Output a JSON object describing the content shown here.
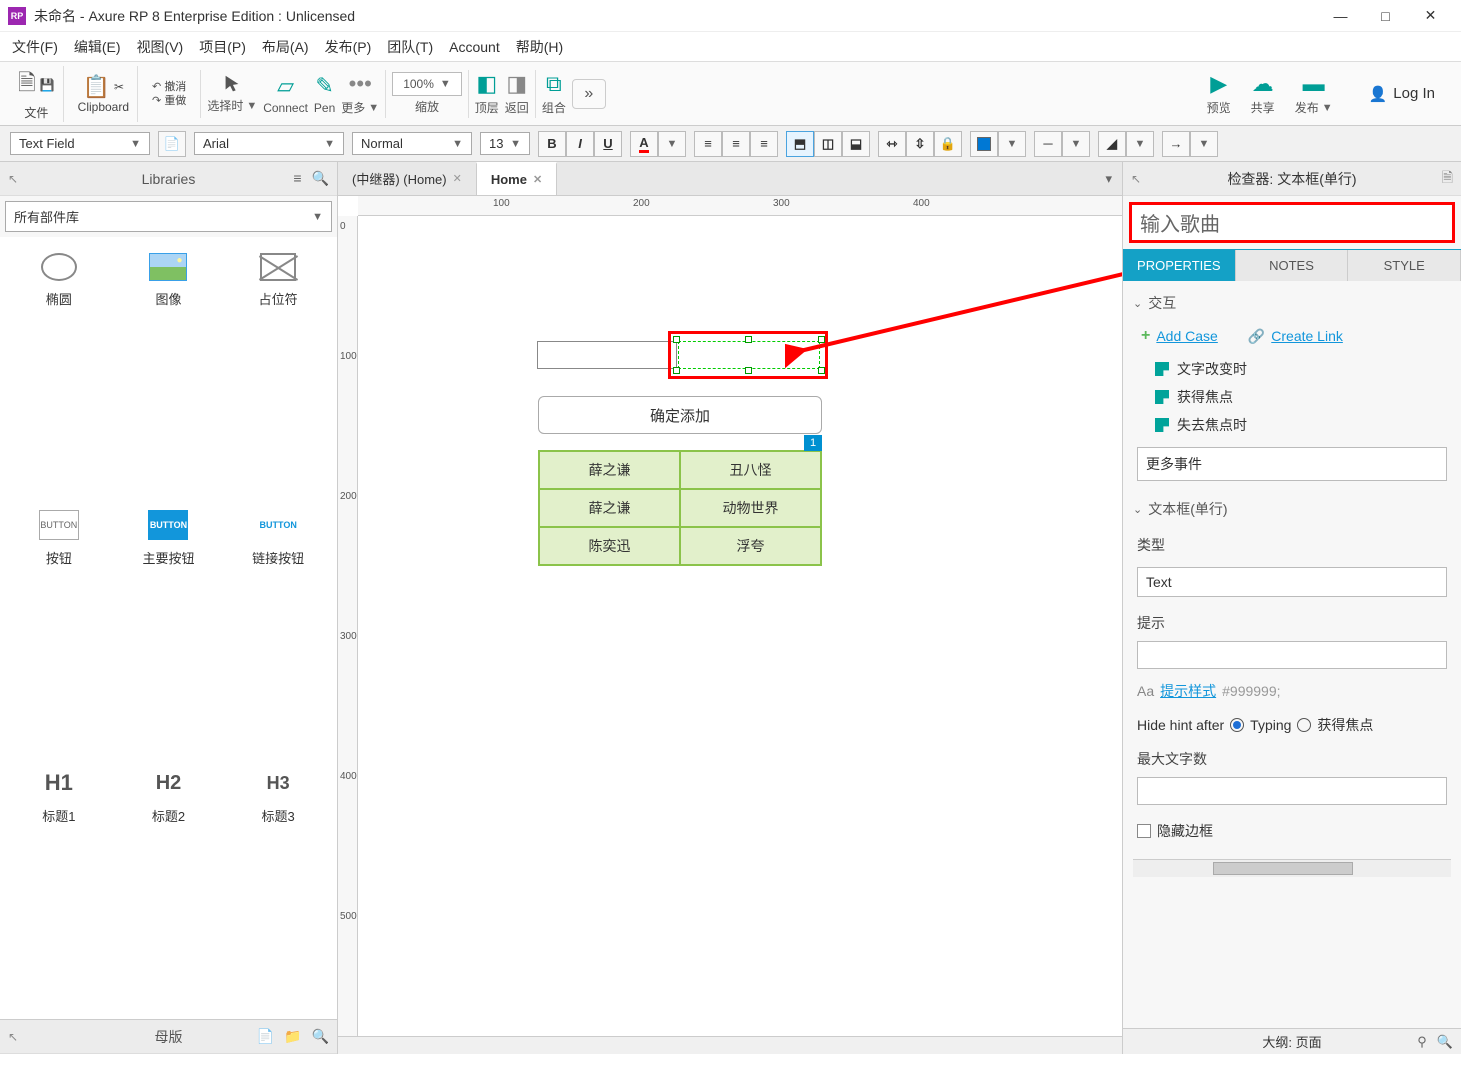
{
  "titlebar": {
    "app_icon": "RP",
    "title": "未命名 - Axure RP 8 Enterprise Edition : Unlicensed"
  },
  "menu": {
    "file": "文件(F)",
    "edit": "编辑(E)",
    "view": "视图(V)",
    "project": "项目(P)",
    "arrange": "布局(A)",
    "publish": "发布(P)",
    "team": "团队(T)",
    "account": "Account",
    "help": "帮助(H)"
  },
  "toolbar": {
    "file": "文件",
    "clipboard": "Clipboard",
    "undo": "撤消",
    "redo": "重做",
    "select": "选择时",
    "connect": "Connect",
    "pen": "Pen",
    "more": "更多",
    "zoom": "缩放",
    "zoom_value": "100%",
    "front": "顶层",
    "back": "返回",
    "group": "组合",
    "more_btn": "»",
    "preview": "预览",
    "share": "共享",
    "publish": "发布",
    "login": "Log In"
  },
  "fmt": {
    "widget_type": "Text Field",
    "font": "Arial",
    "weight": "Normal",
    "size": "13"
  },
  "left": {
    "libraries_title": "Libraries",
    "lib_select": "所有部件库",
    "items": [
      {
        "label": "椭圆"
      },
      {
        "label": "图像"
      },
      {
        "label": "占位符"
      },
      {
        "label": "按钮",
        "txt": "BUTTON"
      },
      {
        "label": "主要按钮",
        "txt": "BUTTON"
      },
      {
        "label": "链接按钮",
        "txt": "BUTTON"
      },
      {
        "label": "标题1",
        "txt": "H1"
      },
      {
        "label": "标题2",
        "txt": "H2"
      },
      {
        "label": "标题3",
        "txt": "H3"
      }
    ],
    "masters_title": "母版"
  },
  "tabs": [
    {
      "label": "(中继器) (Home)",
      "active": false
    },
    {
      "label": "Home",
      "active": true
    }
  ],
  "ruler_h": [
    "100",
    "200",
    "300",
    "400"
  ],
  "ruler_v": [
    "0",
    "100",
    "200",
    "300",
    "400",
    "500"
  ],
  "canvas": {
    "button_label": "确定添加",
    "badge": "1",
    "table": [
      [
        "薛之谦",
        "丑八怪"
      ],
      [
        "薛之谦",
        "动物世界"
      ],
      [
        "陈奕迅",
        "浮夸"
      ]
    ]
  },
  "right": {
    "header": "检查器: 文本框(单行)",
    "name_field": "输入歌曲",
    "tabs": {
      "properties": "PROPERTIES",
      "notes": "NOTES",
      "style": "STYLE"
    },
    "section_interact": "交互",
    "add_case": "Add Case",
    "create_link": "Create Link",
    "events": [
      "文字改变时",
      "获得焦点",
      "失去焦点时"
    ],
    "more_events": "更多事件",
    "section_textfield": "文本框(单行)",
    "type_label": "类型",
    "type_value": "Text",
    "hint_label": "提示",
    "hint_style": "提示样式",
    "hint_color": "#999999;",
    "hide_hint": "Hide hint after",
    "typing": "Typing",
    "focus": "获得焦点",
    "max_label": "最大文字数",
    "hide_border": "隐藏边框",
    "outline": "大纲: 页面"
  }
}
